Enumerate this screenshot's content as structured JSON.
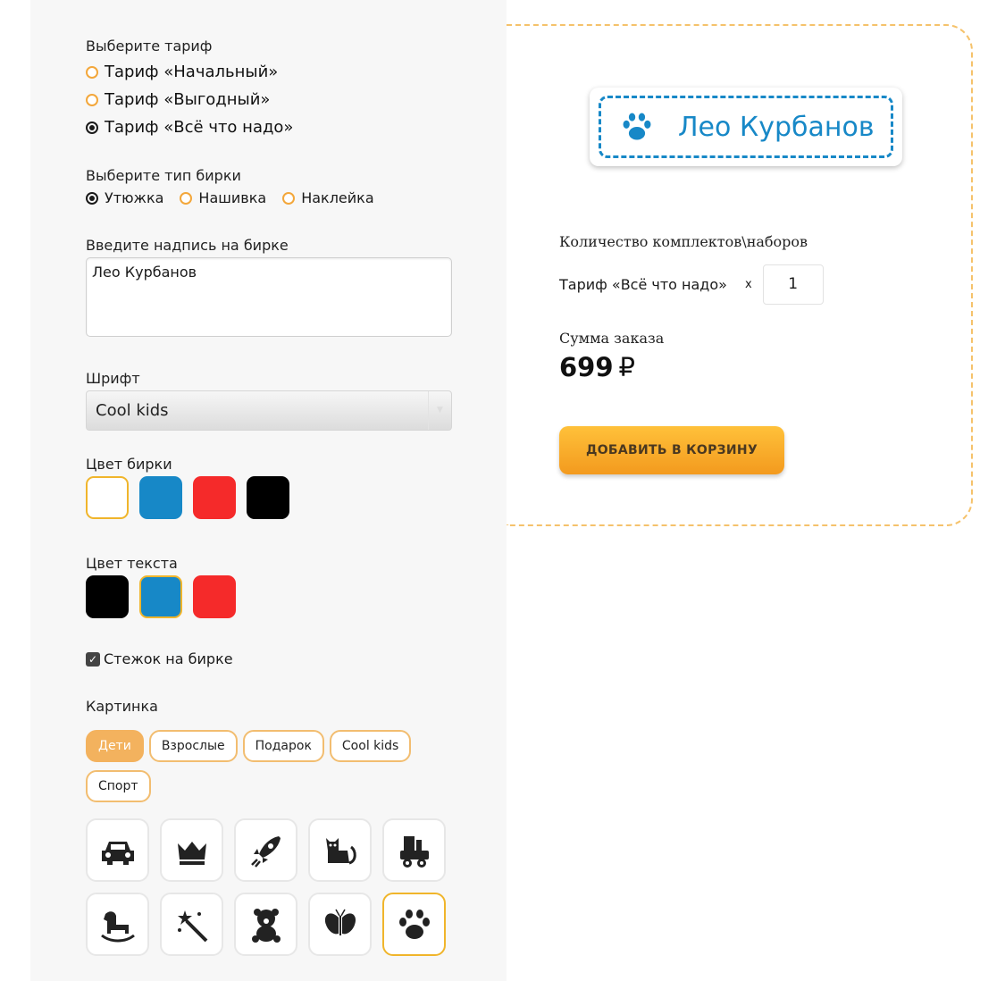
{
  "tariff": {
    "label": "Выберите тариф",
    "options": [
      {
        "label": "Тариф «Начальный»",
        "checked": false
      },
      {
        "label": "Тариф «Выгодный»",
        "checked": false
      },
      {
        "label": "Тариф «Всё что надо»",
        "checked": true
      }
    ]
  },
  "tag_type": {
    "label": "Выберите тип бирки",
    "options": [
      {
        "label": "Утюжка",
        "checked": true
      },
      {
        "label": "Нашивка",
        "checked": false
      },
      {
        "label": "Наклейка",
        "checked": false
      }
    ]
  },
  "inscription": {
    "label": "Введите надпись на бирке",
    "value": "Лео Курбанов"
  },
  "font": {
    "label": "Шрифт",
    "value": "Cool kids"
  },
  "tag_color": {
    "label": "Цвет бирки",
    "colors": [
      "#ffffff",
      "#1788c7",
      "#f52a2a",
      "#000000"
    ],
    "selected": "#ffffff"
  },
  "text_color": {
    "label": "Цвет текста",
    "colors": [
      "#000000",
      "#1788c7",
      "#f52a2a"
    ],
    "selected": "#1788c7"
  },
  "stitch": {
    "label": "Стежок на бирке",
    "checked": true
  },
  "picture": {
    "label": "Картинка",
    "categories": [
      "Дети",
      "Взрослые",
      "Подарок",
      "Cool kids",
      "Спорт"
    ],
    "active_category": "Дети",
    "icons": [
      "car-icon",
      "crown-icon",
      "rocket-icon",
      "cat-icon",
      "locomotive-icon",
      "rocking-horse-icon",
      "magic-wand-icon",
      "teddy-bear-icon",
      "butterfly-icon",
      "paw-icon"
    ],
    "selected_icon": "paw-icon"
  },
  "preview": {
    "text": "Лео Курбанов",
    "icon": "paw-icon",
    "tag_color": "#ffffff",
    "text_color": "#1788c7"
  },
  "order": {
    "qty_label": "Количество комплектов\\наборов",
    "item_label": "Тариф «Всё что надо»",
    "multiply": "x",
    "qty": "1",
    "sum_label": "Сумма заказа",
    "sum_value": "699",
    "currency": "₽",
    "add_to_cart": "ДОБАВИТЬ В КОРЗИНУ"
  },
  "accent_color": "#f3a73b"
}
